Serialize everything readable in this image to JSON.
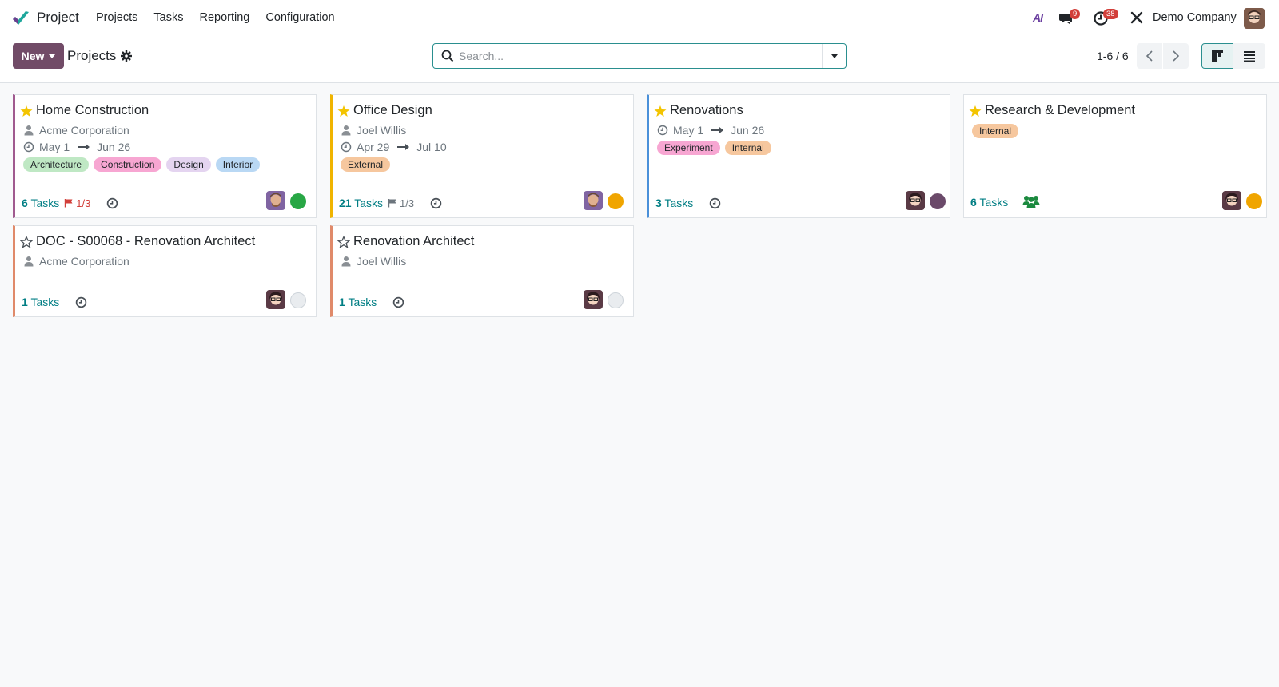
{
  "navbar": {
    "app_name": "Project",
    "menu": [
      "Projects",
      "Tasks",
      "Reporting",
      "Configuration"
    ],
    "ai_label": "AI",
    "messages_count": "9",
    "activities_count": "38",
    "company": "Demo Company"
  },
  "control": {
    "new_label": "New",
    "breadcrumb": "Projects",
    "search_placeholder": "Search...",
    "pager": "1-6 / 6"
  },
  "colors": {
    "brand": "#714b67",
    "accent": "#017e84",
    "danger": "#d23f3a"
  },
  "projects": [
    {
      "name": "Home Construction",
      "favorite": true,
      "customer": "Acme Corporation",
      "date_start": "May 1",
      "date_end": "Jun 26",
      "tags": [
        "Architecture",
        "Construction",
        "Design",
        "Interior"
      ],
      "tasks_count": "6",
      "tasks_label": "Tasks",
      "milestone": "1/3",
      "status_color": "#28a745"
    },
    {
      "name": "Office Design",
      "favorite": true,
      "customer": "Joel Willis",
      "date_start": "Apr 29",
      "date_end": "Jul 10",
      "tags": [
        "External"
      ],
      "tasks_count": "21",
      "tasks_label": "Tasks",
      "milestone": "1/3",
      "status_color": "#f0a500"
    },
    {
      "name": "Renovations",
      "favorite": true,
      "date_start": "May 1",
      "date_end": "Jun 26",
      "tags": [
        "Experiment",
        "Internal"
      ],
      "tasks_count": "3",
      "tasks_label": "Tasks",
      "status_color": "#6b4a6a"
    },
    {
      "name": "Research & Development",
      "favorite": true,
      "tags": [
        "Internal"
      ],
      "tasks_count": "6",
      "tasks_label": "Tasks",
      "status_color": "#f0a500"
    },
    {
      "name": "DOC - S00068 - Renovation Architect",
      "favorite": false,
      "customer": "Acme Corporation",
      "tasks_count": "1",
      "tasks_label": "Tasks",
      "status_color": "#e9ecef"
    },
    {
      "name": "Renovation Architect",
      "favorite": false,
      "customer": "Joel Willis",
      "tasks_count": "1",
      "tasks_label": "Tasks",
      "status_color": "#e9ecef"
    }
  ]
}
